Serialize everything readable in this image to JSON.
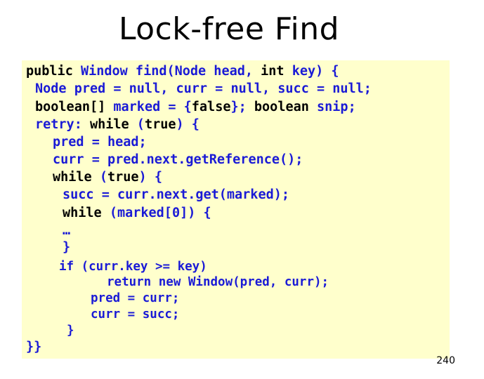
{
  "slide": {
    "title": "Lock-free Find",
    "page_number": "240"
  },
  "colors": {
    "keyword": "#000000",
    "identifier": "#1a1ad6",
    "code_background": "#ffffcc"
  },
  "code": {
    "l1": [
      "public",
      " Window find(Node head, ",
      "int",
      " key) {"
    ],
    "l2": [
      "Node pred = null, curr = null, succ = null;"
    ],
    "l3": [
      "boolean[]",
      " marked = {",
      "false",
      "}; ",
      "boolean",
      " snip;"
    ],
    "l4": [
      "retry: ",
      "while",
      " (",
      "true",
      ") {"
    ],
    "l5": [
      "pred = head;"
    ],
    "l6": [
      "curr = pred.next.getReference();"
    ],
    "l7": [
      "while",
      " (",
      "true",
      ") {"
    ],
    "l8": [
      "succ = curr.next.get(marked);"
    ],
    "l9": [
      "while",
      " (marked[0]) {"
    ],
    "l10": [
      "…"
    ],
    "l11": [
      "}"
    ],
    "l12": [
      "if",
      " (curr.key >= key)"
    ],
    "l13": [
      "return new",
      " Window(pred, curr);"
    ],
    "l14": [
      "pred = curr;"
    ],
    "l15": [
      "curr = succ;"
    ],
    "l16": [
      "}"
    ],
    "l17": [
      "}}"
    ]
  }
}
